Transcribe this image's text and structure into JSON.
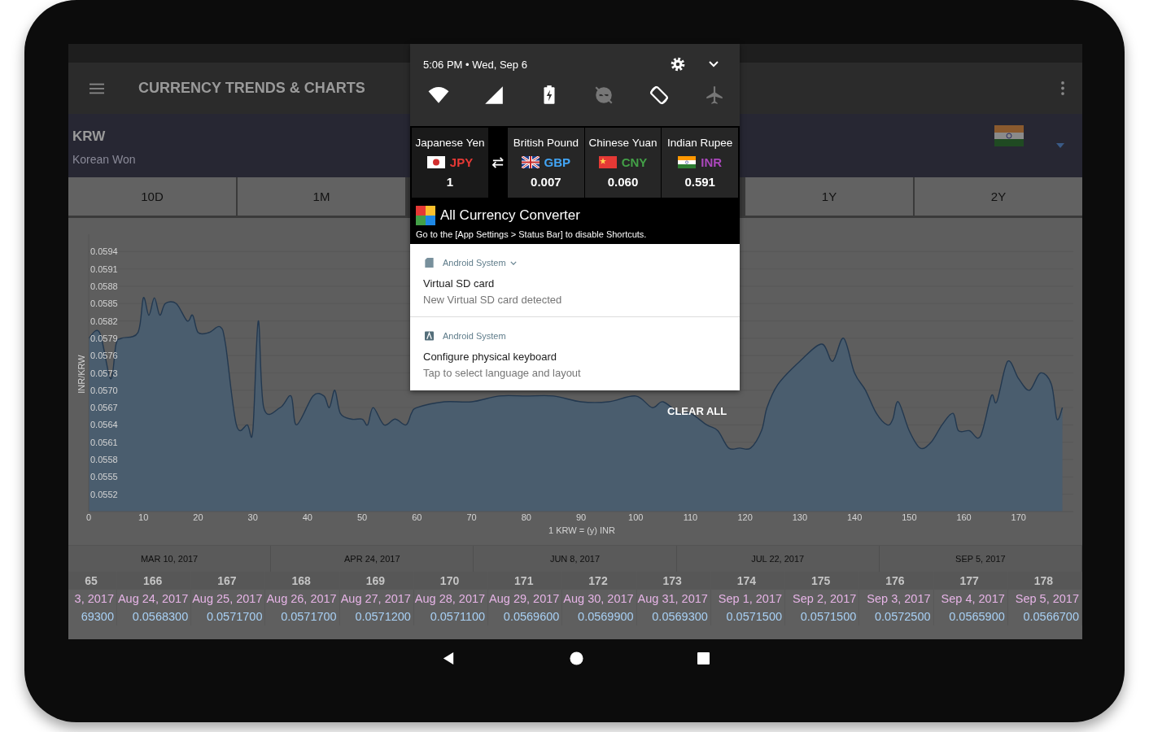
{
  "status_bar": {
    "datetime": "5:06 PM • Wed, Sep 6"
  },
  "quick_settings": [
    {
      "kind": "wifi",
      "on": true
    },
    {
      "kind": "signal",
      "on": true
    },
    {
      "kind": "battery",
      "on": true
    },
    {
      "kind": "dnd",
      "on": false
    },
    {
      "kind": "rotate",
      "on": true
    },
    {
      "kind": "airplane",
      "on": false
    }
  ],
  "widget": {
    "currencies": [
      {
        "name": "Japanese Yen",
        "code": "JPY",
        "value": "1",
        "color": "#e53935"
      },
      {
        "name": "British Pound",
        "code": "GBP",
        "value": "0.007",
        "color": "#42a5f5"
      },
      {
        "name": "Chinese Yuan",
        "code": "CNY",
        "value": "0.060",
        "color": "#43a047"
      },
      {
        "name": "Indian Rupee",
        "code": "INR",
        "value": "0.591",
        "color": "#ab47bc"
      }
    ],
    "app_title": "All Currency Converter",
    "hint": "Go to the [App Settings > Status Bar] to disable Shortcuts."
  },
  "notifications": [
    {
      "kind": "sd",
      "app": "Android System",
      "expandable": true,
      "title": "Virtual SD card",
      "text": "New Virtual SD card detected"
    },
    {
      "kind": "keyboard",
      "app": "Android System",
      "expandable": false,
      "title": "Configure physical keyboard",
      "text": "Tap to select language and layout"
    }
  ],
  "clear_all": "CLEAR ALL",
  "app_bar": {
    "title": "CURRENCY TRENDS & CHARTS"
  },
  "header": {
    "code": "KRW",
    "name": "Korean Won"
  },
  "tabs": [
    {
      "label": "10D"
    },
    {
      "label": "1M"
    },
    {
      "label": "1Y"
    },
    {
      "label": "2Y"
    }
  ],
  "chart": {
    "chart_data": {
      "type": "area",
      "xlabel": "1 KRW = (y) INR",
      "ylabel": "INR/KRW",
      "x": [
        0,
        2,
        4,
        5,
        6,
        9,
        10,
        11,
        12,
        13,
        14,
        16,
        18,
        19,
        20,
        22,
        24,
        25,
        27,
        29,
        30,
        31,
        32,
        35,
        37,
        38,
        41,
        43,
        44,
        45,
        46,
        48,
        50,
        51,
        52,
        54,
        56,
        58,
        59,
        60,
        65,
        70,
        75,
        80,
        85,
        90,
        95,
        100,
        103,
        105,
        108,
        110,
        113,
        115,
        117,
        119,
        121,
        123,
        124,
        126,
        130,
        134,
        136,
        138,
        140,
        142,
        144,
        146,
        147,
        148,
        150,
        152,
        154,
        156,
        158,
        159,
        161,
        163,
        165,
        166,
        168,
        170,
        172,
        174,
        176,
        177,
        178
      ],
      "grid": true,
      "series": [
        {
          "color": "#4a5d6e",
          "values": [
            0.0579,
            0.058,
            0.0572,
            0.0578,
            0.0579,
            0.058,
            0.0586,
            0.0583,
            0.0586,
            0.0583,
            0.0585,
            0.0585,
            0.0582,
            0.0583,
            0.058,
            0.058,
            0.0581,
            0.0578,
            0.0564,
            0.0564,
            0.0563,
            0.0582,
            0.0567,
            0.0567,
            0.0569,
            0.0564,
            0.0569,
            0.0569,
            0.0567,
            0.057,
            0.0566,
            0.0565,
            0.0565,
            0.0564,
            0.0567,
            0.0564,
            0.0565,
            0.0564,
            0.0566,
            0.0567,
            0.0568,
            0.0568,
            0.0569,
            0.0569,
            0.0569,
            0.0568,
            0.0568,
            0.0569,
            0.0567,
            0.0568,
            0.0566,
            0.0566,
            0.0564,
            0.0563,
            0.056,
            0.056,
            0.056,
            0.0563,
            0.0567,
            0.0571,
            0.0575,
            0.0578,
            0.0575,
            0.0579,
            0.0573,
            0.057,
            0.0566,
            0.0564,
            0.0565,
            0.0568,
            0.0563,
            0.056,
            0.0561,
            0.0564,
            0.0566,
            0.0563,
            0.0563,
            0.0562,
            0.0569,
            0.0568,
            0.0575,
            0.0572,
            0.057,
            0.0573,
            0.0571,
            0.0565,
            0.0567
          ]
        }
      ],
      "xlim": [
        0,
        180
      ],
      "ylim": [
        0.0549,
        0.0597
      ],
      "xticks": [
        0,
        10,
        20,
        30,
        40,
        50,
        60,
        70,
        80,
        90,
        100,
        110,
        120,
        130,
        140,
        150,
        160,
        170
      ],
      "yticks": [
        {
          "value": 0.0594,
          "label": "0.0594"
        },
        {
          "value": 0.0591,
          "label": "0.0591"
        },
        {
          "value": 0.0588,
          "label": "0.0588"
        },
        {
          "value": 0.0585,
          "label": "0.0585"
        },
        {
          "value": 0.0582,
          "label": "0.0582"
        },
        {
          "value": 0.0579,
          "label": "0.0579"
        },
        {
          "value": 0.0576,
          "label": "0.0576"
        },
        {
          "value": 0.0573,
          "label": "0.0573"
        },
        {
          "value": 0.057,
          "label": "0.0570"
        },
        {
          "value": 0.0567,
          "label": "0.0567"
        },
        {
          "value": 0.0564,
          "label": "0.0564"
        },
        {
          "value": 0.0561,
          "label": "0.0561"
        },
        {
          "value": 0.0558,
          "label": "0.0558"
        },
        {
          "value": 0.0555,
          "label": "0.0555"
        },
        {
          "value": 0.0552,
          "label": "0.0552"
        }
      ]
    }
  },
  "navigator": [
    "MAR 10, 2017",
    "APR 24, 2017",
    "JUN 8, 2017",
    "JUL 22, 2017",
    "SEP 5, 2017"
  ],
  "table": {
    "columns": [
      {
        "index": "65",
        "date": "3, 2017",
        "rate": "69300"
      },
      {
        "index": "166",
        "date": "Aug 24, 2017",
        "rate": "0.0568300"
      },
      {
        "index": "167",
        "date": "Aug 25, 2017",
        "rate": "0.0571700"
      },
      {
        "index": "168",
        "date": "Aug 26, 2017",
        "rate": "0.0571700"
      },
      {
        "index": "169",
        "date": "Aug 27, 2017",
        "rate": "0.0571200"
      },
      {
        "index": "170",
        "date": "Aug 28, 2017",
        "rate": "0.0571100"
      },
      {
        "index": "171",
        "date": "Aug 29, 2017",
        "rate": "0.0569600"
      },
      {
        "index": "172",
        "date": "Aug 30, 2017",
        "rate": "0.0569900"
      },
      {
        "index": "173",
        "date": "Aug 31, 2017",
        "rate": "0.0569300"
      },
      {
        "index": "174",
        "date": "Sep 1, 2017",
        "rate": "0.0571500"
      },
      {
        "index": "175",
        "date": "Sep 2, 2017",
        "rate": "0.0571500"
      },
      {
        "index": "176",
        "date": "Sep 3, 2017",
        "rate": "0.0572500"
      },
      {
        "index": "177",
        "date": "Sep 4, 2017",
        "rate": "0.0565900"
      },
      {
        "index": "178",
        "date": "Sep 5, 2017",
        "rate": "0.0566700"
      }
    ]
  }
}
